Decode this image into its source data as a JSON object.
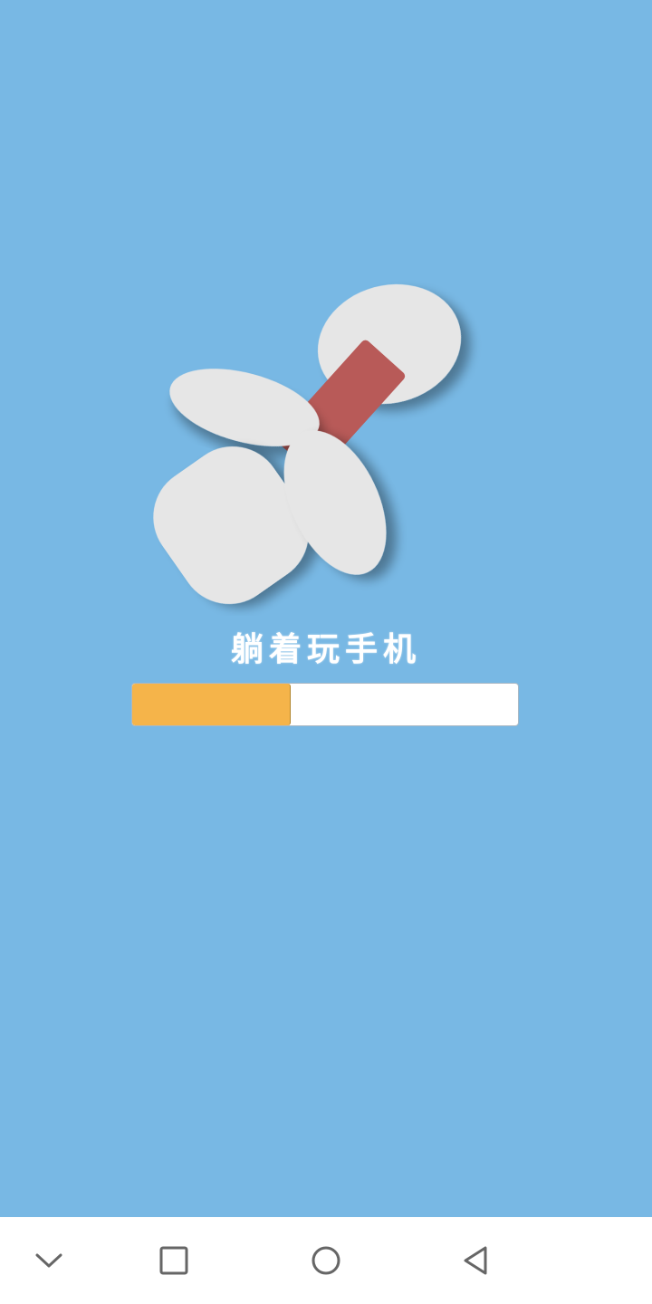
{
  "app": {
    "title": "躺着玩手机",
    "splash_art": "hands-holding-phone-illustration"
  },
  "loading": {
    "progress": 0.41
  },
  "nav_bar": {
    "buttons": [
      {
        "icon": "chevron-down-icon"
      },
      {
        "icon": "recents-square-icon"
      },
      {
        "icon": "home-circle-icon"
      },
      {
        "icon": "back-triangle-icon"
      }
    ]
  },
  "colors": {
    "background": "#78b8e4",
    "progress_fill": "#f5b44a",
    "progress_track": "#ffffff",
    "phone": "#b85a58",
    "hands": "#e6e6e6"
  }
}
